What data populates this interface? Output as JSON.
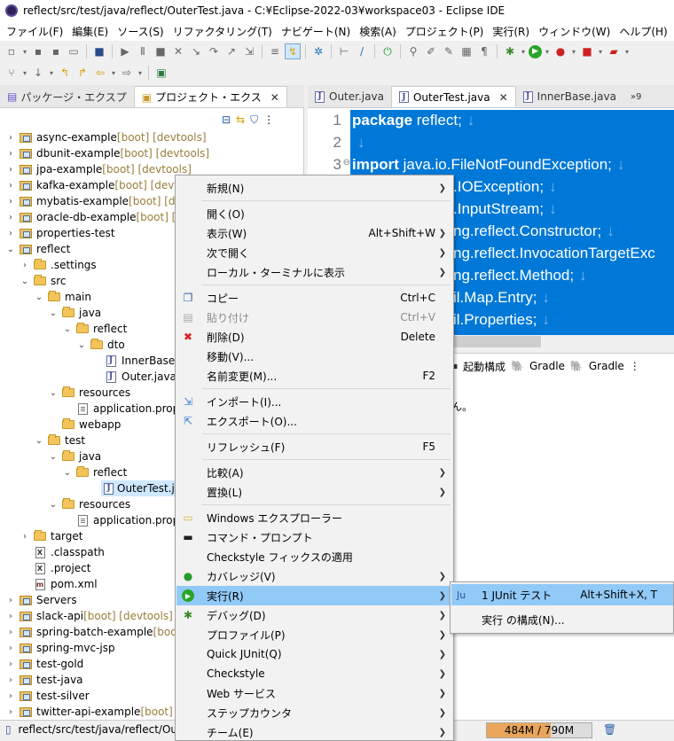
{
  "window": {
    "title": "reflect/src/test/java/reflect/OuterTest.java - C:¥Eclipse-2022-03¥workspace03 - Eclipse IDE"
  },
  "menubar": [
    "ファイル(F)",
    "編集(E)",
    "ソース(S)",
    "リファクタリング(T)",
    "ナビゲート(N)",
    "検索(A)",
    "プロジェクト(P)",
    "実行(R)",
    "ウィンドウ(W)",
    "ヘルプ(H)"
  ],
  "left_view": {
    "tabs": [
      {
        "label": "パッケージ・エクスプ"
      },
      {
        "label": "プロジェクト・エクス",
        "close": "✕"
      }
    ],
    "tree": [
      {
        "tw": "›",
        "icon": "project",
        "label": "async-example",
        "deco": " [boot] [devtools]"
      },
      {
        "tw": "›",
        "icon": "project",
        "label": "dbunit-example",
        "deco": " [boot] [devtools]"
      },
      {
        "tw": "›",
        "icon": "project",
        "label": "jpa-example",
        "deco": " [boot] [devtools]"
      },
      {
        "tw": "›",
        "icon": "project",
        "label": "kafka-example",
        "deco": " [boot] [devtoo"
      },
      {
        "tw": "›",
        "icon": "project",
        "label": "mybatis-example",
        "deco": " [boot] [dev"
      },
      {
        "tw": "›",
        "icon": "project",
        "label": "oracle-db-example",
        "deco": " [boot] [de"
      },
      {
        "tw": "›",
        "icon": "project",
        "label": "properties-test",
        "deco": ""
      },
      {
        "tw": "⌄",
        "icon": "project",
        "label": "reflect",
        "deco": ""
      },
      {
        "tw": "›",
        "icon": "folder",
        "label": ".settings",
        "deco": ""
      },
      {
        "tw": "⌄",
        "icon": "folder",
        "label": "src",
        "deco": ""
      },
      {
        "tw": "⌄",
        "icon": "folder",
        "label": "main",
        "deco": ""
      },
      {
        "tw": "⌄",
        "icon": "folder",
        "label": "java",
        "deco": ""
      },
      {
        "tw": "⌄",
        "icon": "folder",
        "label": "reflect",
        "deco": ""
      },
      {
        "tw": "⌄",
        "icon": "folder",
        "label": "dto",
        "deco": ""
      },
      {
        "tw": "",
        "icon": "java",
        "label": "InnerBase.ja",
        "deco": ""
      },
      {
        "tw": "",
        "icon": "java",
        "label": "Outer.java",
        "deco": ""
      },
      {
        "tw": "⌄",
        "icon": "folder",
        "label": "resources",
        "deco": ""
      },
      {
        "tw": "",
        "icon": "props",
        "label": "application.prope",
        "deco": ""
      },
      {
        "tw": "",
        "icon": "folder",
        "label": "webapp",
        "deco": ""
      },
      {
        "tw": "⌄",
        "icon": "folder",
        "label": "test",
        "deco": ""
      },
      {
        "tw": "⌄",
        "icon": "folder",
        "label": "java",
        "deco": ""
      },
      {
        "tw": "⌄",
        "icon": "folder",
        "label": "reflect",
        "deco": ""
      },
      {
        "tw": "",
        "icon": "java",
        "label": "OuterTest.java",
        "deco": "",
        "selected": true
      },
      {
        "tw": "⌄",
        "icon": "folder",
        "label": "resources",
        "deco": ""
      },
      {
        "tw": "",
        "icon": "props",
        "label": "application.prope",
        "deco": ""
      },
      {
        "tw": "›",
        "icon": "folder",
        "label": "target",
        "deco": ""
      },
      {
        "tw": "",
        "icon": "xml",
        "label": ".classpath",
        "deco": ""
      },
      {
        "tw": "",
        "icon": "xml",
        "label": ".project",
        "deco": ""
      },
      {
        "tw": "",
        "icon": "maven",
        "label": "pom.xml",
        "deco": ""
      },
      {
        "tw": "›",
        "icon": "project",
        "label": "Servers",
        "deco": ""
      },
      {
        "tw": "›",
        "icon": "project",
        "label": "slack-api",
        "deco": " [boot] [devtools]"
      },
      {
        "tw": "›",
        "icon": "project",
        "label": "spring-batch-example",
        "deco": " [boot"
      },
      {
        "tw": "›",
        "icon": "project",
        "label": "spring-mvc-jsp",
        "deco": ""
      },
      {
        "tw": "›",
        "icon": "project",
        "label": "test-gold",
        "deco": ""
      },
      {
        "tw": "›",
        "icon": "project",
        "label": "test-java",
        "deco": ""
      },
      {
        "tw": "›",
        "icon": "project",
        "label": "test-silver",
        "deco": ""
      },
      {
        "tw": "›",
        "icon": "project",
        "label": "twitter-api-example",
        "deco": " [boot] [d"
      }
    ]
  },
  "editor": {
    "tabs": [
      {
        "label": "Outer.java",
        "active": false,
        "close": ""
      },
      {
        "label": "OuterTest.java",
        "active": true,
        "close": "✕"
      },
      {
        "label": "InnerBase.java",
        "active": false,
        "close": ""
      },
      {
        "label": "»9",
        "active": false,
        "close": ""
      }
    ],
    "line_numbers": [
      "1",
      "2",
      "3"
    ],
    "lines": [
      {
        "kw": "package",
        "text": " reflect;",
        "nl": "↓"
      },
      {
        "kw": "",
        "text": "",
        "nl": "↓"
      },
      {
        "kw": "import",
        "text": " java.io.FileNotFoundException;",
        "nl": "↓"
      },
      {
        "kw": "",
        "text": ".IOException;",
        "nl": "↓"
      },
      {
        "kw": "",
        "text": ".InputStream;",
        "nl": "↓"
      },
      {
        "kw": "",
        "text": "ng.reflect.Constructor;",
        "nl": "↓"
      },
      {
        "kw": "",
        "text": "ng.reflect.InvocationTargetExc",
        "nl": ""
      },
      {
        "kw": "",
        "text": "ng.reflect.Method;",
        "nl": "↓"
      },
      {
        "kw": "",
        "text": "il.Map.Entry;",
        "nl": "↓"
      },
      {
        "kw": "",
        "text": "il.Properties;",
        "nl": "↓"
      }
    ]
  },
  "bottom_panel": {
    "tabs": [
      "起動構成",
      "Gradle",
      "Gradle"
    ],
    "message": "ん。"
  },
  "status": {
    "path": "reflect/src/test/java/reflect/Outer",
    "heap_text": "484M / 790M",
    "heap_used_fraction": 0.61
  },
  "context_menu": {
    "items": [
      {
        "type": "item",
        "label": "新規(N)",
        "accel": "",
        "submenu": true,
        "icon": ""
      },
      {
        "type": "sep"
      },
      {
        "type": "item",
        "label": "開く(O)",
        "accel": "",
        "submenu": false,
        "icon": ""
      },
      {
        "type": "item",
        "label": "表示(W)",
        "accel": "Alt+Shift+W",
        "submenu": true,
        "icon": ""
      },
      {
        "type": "item",
        "label": "次で開く",
        "accel": "",
        "submenu": true,
        "icon": ""
      },
      {
        "type": "item",
        "label": "ローカル・ターミナルに表示",
        "accel": "",
        "submenu": true,
        "icon": ""
      },
      {
        "type": "sep"
      },
      {
        "type": "item",
        "label": "コピー",
        "accel": "Ctrl+C",
        "submenu": false,
        "icon": "copy-icon"
      },
      {
        "type": "item",
        "label": "貼り付け",
        "accel": "Ctrl+V",
        "submenu": false,
        "icon": "paste-icon",
        "disabled": true
      },
      {
        "type": "item",
        "label": "削除(D)",
        "accel": "Delete",
        "submenu": false,
        "icon": "delete-icon"
      },
      {
        "type": "item",
        "label": "移動(V)...",
        "accel": "",
        "submenu": false,
        "icon": ""
      },
      {
        "type": "item",
        "label": "名前変更(M)...",
        "accel": "F2",
        "submenu": false,
        "icon": ""
      },
      {
        "type": "sep"
      },
      {
        "type": "item",
        "label": "インポート(I)...",
        "accel": "",
        "submenu": false,
        "icon": "import-icon"
      },
      {
        "type": "item",
        "label": "エクスポート(O)...",
        "accel": "",
        "submenu": false,
        "icon": "export-icon"
      },
      {
        "type": "sep"
      },
      {
        "type": "item",
        "label": "リフレッシュ(F)",
        "accel": "F5",
        "submenu": false,
        "icon": "refresh-icon"
      },
      {
        "type": "sep"
      },
      {
        "type": "item",
        "label": "比較(A)",
        "accel": "",
        "submenu": true,
        "icon": ""
      },
      {
        "type": "item",
        "label": "置換(L)",
        "accel": "",
        "submenu": true,
        "icon": ""
      },
      {
        "type": "sep"
      },
      {
        "type": "item",
        "label": "Windows エクスプローラー",
        "accel": "",
        "submenu": false,
        "icon": "explorer-icon"
      },
      {
        "type": "item",
        "label": "コマンド・プロンプト",
        "accel": "",
        "submenu": false,
        "icon": "terminal-icon"
      },
      {
        "type": "item",
        "label": "Checkstyle フィックスの適用",
        "accel": "",
        "submenu": false,
        "icon": ""
      },
      {
        "type": "item",
        "label": "カバレッジ(V)",
        "accel": "",
        "submenu": true,
        "icon": "coverage-icon"
      },
      {
        "type": "item",
        "label": "実行(R)",
        "accel": "",
        "submenu": true,
        "icon": "run-icon",
        "highlighted": true
      },
      {
        "type": "item",
        "label": "デバッグ(D)",
        "accel": "",
        "submenu": true,
        "icon": "debug-icon"
      },
      {
        "type": "item",
        "label": "プロファイル(P)",
        "accel": "",
        "submenu": true,
        "icon": ""
      },
      {
        "type": "item",
        "label": "Quick JUnit(Q)",
        "accel": "",
        "submenu": true,
        "icon": ""
      },
      {
        "type": "item",
        "label": "Checkstyle",
        "accel": "",
        "submenu": true,
        "icon": ""
      },
      {
        "type": "item",
        "label": "Web サービス",
        "accel": "",
        "submenu": true,
        "icon": ""
      },
      {
        "type": "item",
        "label": "ステップカウンタ",
        "accel": "",
        "submenu": true,
        "icon": ""
      },
      {
        "type": "item",
        "label": "チーム(E)",
        "accel": "",
        "submenu": true,
        "icon": ""
      }
    ]
  },
  "run_submenu": {
    "items": [
      {
        "label": "1 JUnit テスト",
        "accel": "Alt+Shift+X, T",
        "icon": "junit-icon",
        "highlighted": true
      },
      {
        "label": "実行 の構成(N)...",
        "accel": "",
        "icon": ""
      }
    ]
  }
}
